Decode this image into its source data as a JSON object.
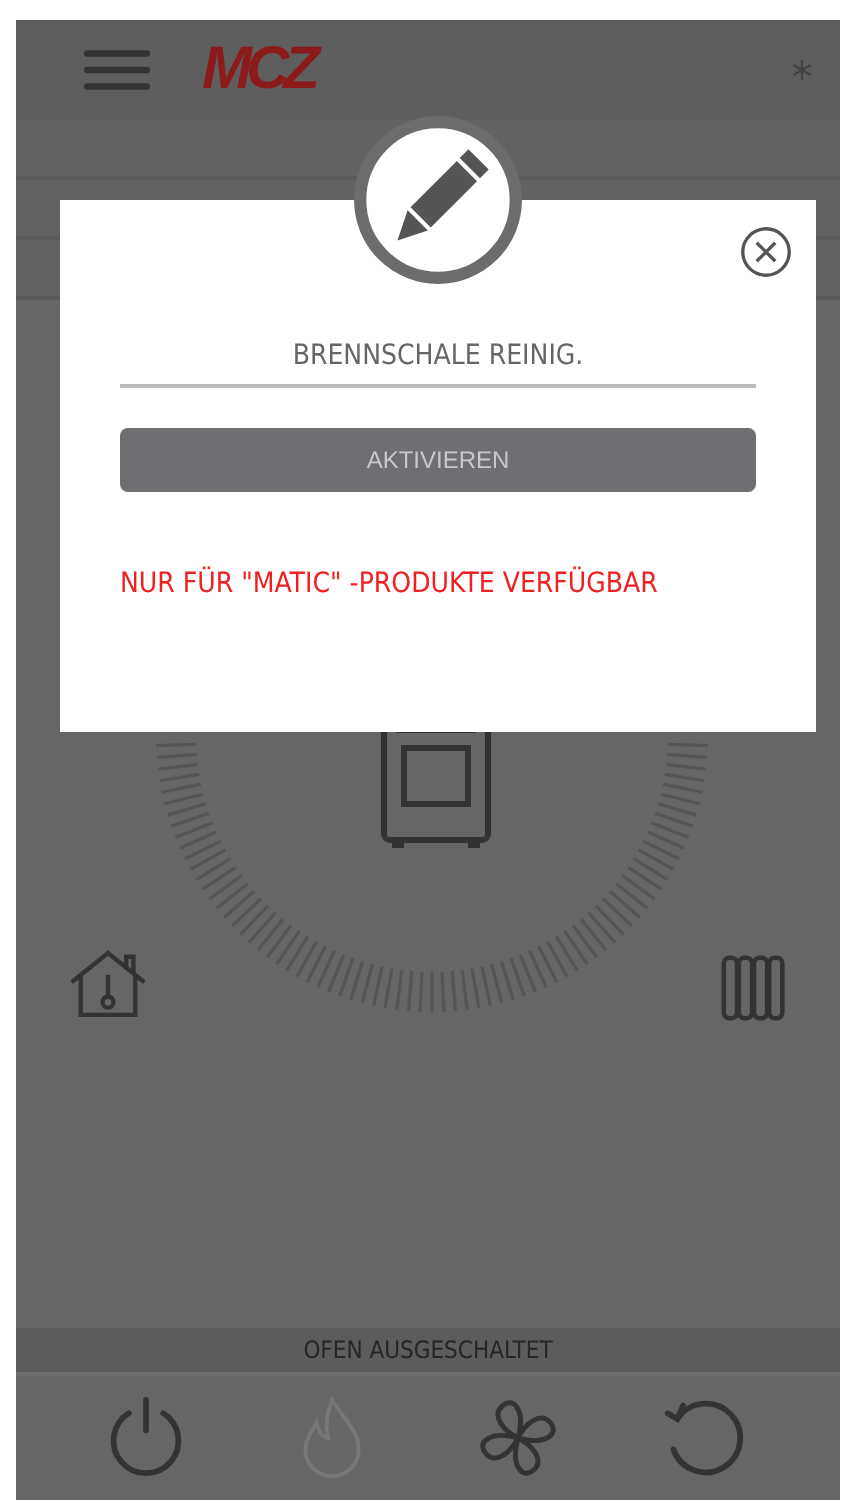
{
  "header": {
    "logo": "MCZ"
  },
  "dialog": {
    "field_value": "BRENNSCHALE REINIG.",
    "button": {
      "label": "AKTIVIEREN",
      "disabled": true
    },
    "notice": "NUR FÜR \"MATIC\" -PRODUKTE VERFÜGBAR"
  },
  "status_bar": "OFEN AUSGESCHALTET",
  "bottom_bar": [
    {
      "kind": "power",
      "disabled": false
    },
    {
      "kind": "flame",
      "disabled": true
    },
    {
      "kind": "fan",
      "disabled": false
    },
    {
      "kind": "reset",
      "disabled": false
    }
  ]
}
